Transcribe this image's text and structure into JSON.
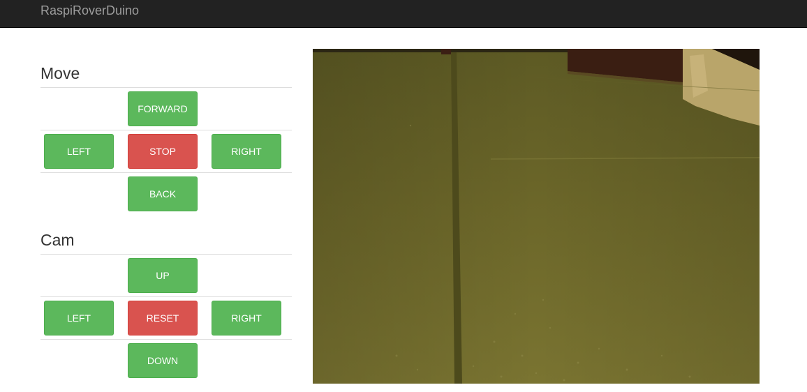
{
  "navbar": {
    "brand": "RaspiRoverDuino"
  },
  "move": {
    "title": "Move",
    "forward": "FORWARD",
    "left": "LEFT",
    "stop": "STOP",
    "right": "RIGHT",
    "back": "BACK"
  },
  "cam": {
    "title": "Cam",
    "up": "UP",
    "left": "LEFT",
    "reset": "RESET",
    "right": "RIGHT",
    "down": "DOWN"
  },
  "colors": {
    "navbar_bg": "#222222",
    "brand_text": "#9d9d9d",
    "success": "#5cb85c",
    "danger": "#d9534f",
    "floor": "#6f6a2c"
  }
}
